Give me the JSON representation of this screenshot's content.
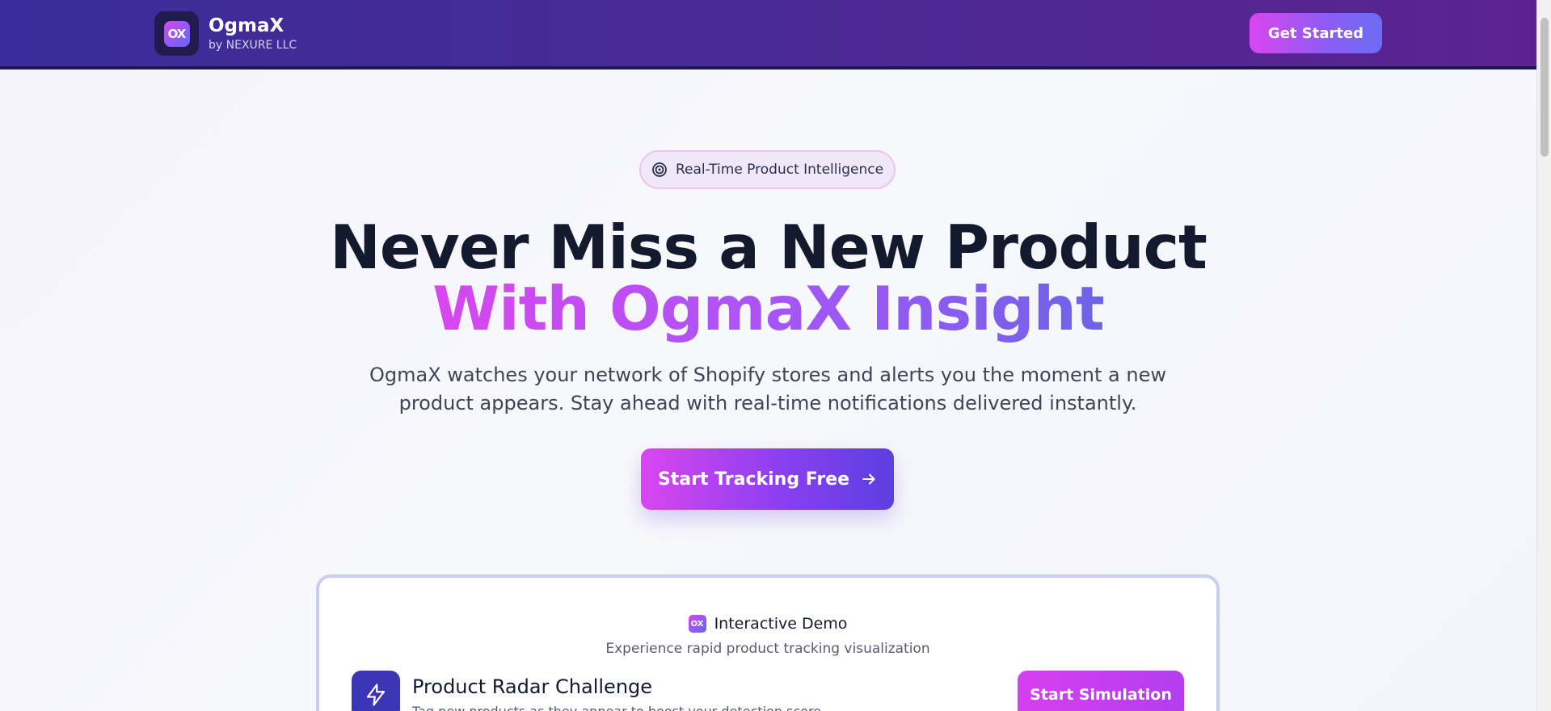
{
  "header": {
    "logo_text": "OX",
    "brand_name": "OgmaX",
    "brand_sub": "by NEXURE LLC",
    "cta_label": "Get Started"
  },
  "hero": {
    "badge": "Real-Time Product Intelligence",
    "title_line1": "Never Miss a New Product",
    "title_line2": "With OgmaX Insight",
    "description": "OgmaX watches your network of Shopify stores and alerts you the moment a new product appears. Stay ahead with real-time notifications delivered instantly.",
    "cta_label": "Start Tracking Free"
  },
  "demo": {
    "logo_text": "OX",
    "title": "Interactive Demo",
    "subtitle": "Experience rapid product tracking visualization",
    "challenge_title": "Product Radar Challenge",
    "challenge_sub": "Tag new products as they appear to boost your detection score",
    "button_label": "Start Simulation"
  },
  "icons": {
    "badge": "target-icon",
    "cta": "arrow-right-icon",
    "challenge": "lightning-icon"
  },
  "colors": {
    "header_start": "#3a2c9a",
    "header_end": "#5c2390",
    "accent_pink": "#d946ef",
    "accent_indigo": "#6366f1",
    "text_dark": "#131a2e"
  }
}
